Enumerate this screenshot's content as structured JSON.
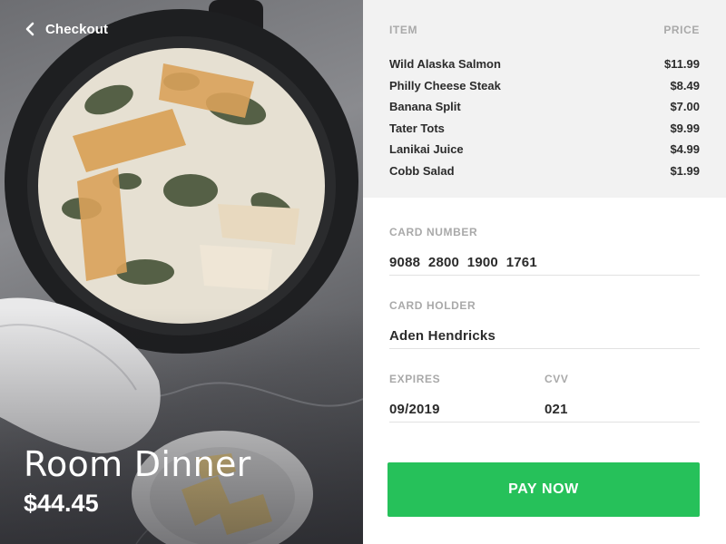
{
  "header": {
    "back_label": "Checkout"
  },
  "hero": {
    "title": "Room Dinner",
    "total": "$44.45"
  },
  "order": {
    "item_header": "ITEM",
    "price_header": "PRICE",
    "items": [
      {
        "name": "Wild Alaska Salmon",
        "price": "$11.99"
      },
      {
        "name": "Philly Cheese Steak",
        "price": "$8.49"
      },
      {
        "name": "Banana Split",
        "price": "$7.00"
      },
      {
        "name": "Tater Tots",
        "price": "$9.99"
      },
      {
        "name": "Lanikai Juice",
        "price": "$4.99"
      },
      {
        "name": "Cobb Salad",
        "price": "$1.99"
      }
    ]
  },
  "payment": {
    "card_number_label": "CARD NUMBER",
    "card_number": "9088  2800  1900  1761",
    "card_holder_label": "CARD HOLDER",
    "card_holder": "Aden Hendricks",
    "expires_label": "EXPIRES",
    "expires": "09/2019",
    "cvv_label": "CVV",
    "cvv": "021",
    "pay_button": "PAY NOW"
  },
  "colors": {
    "accent": "#26c15a",
    "summary_background": "#f2f2f2",
    "label_gray": "#a9a9a9",
    "text_dark": "#2b2b2b"
  },
  "icons": {
    "back": "chevron-left-icon"
  }
}
